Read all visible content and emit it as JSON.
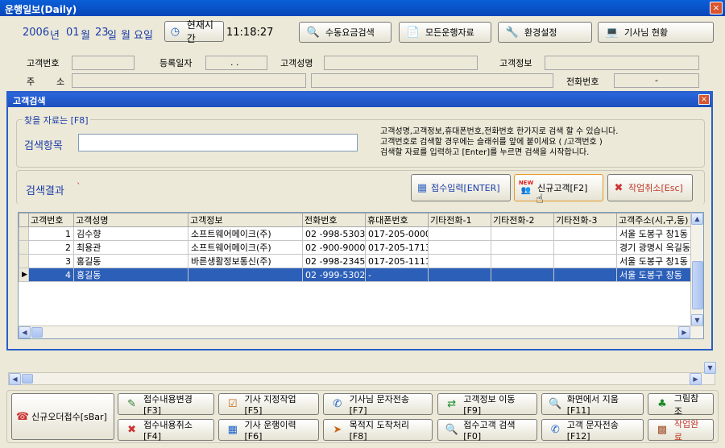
{
  "window": {
    "title": "운행일보(Daily)",
    "close": "×"
  },
  "date": {
    "year": "2006",
    "year_unit": "년",
    "month": "01",
    "month_unit": "월",
    "day": "23",
    "day_unit": "일",
    "weekday": "월",
    "weekday_unit": "요일"
  },
  "clock": {
    "button_label": "현재시간",
    "time": "11:18:27"
  },
  "toolbar": {
    "manual_fare": "수동요금검색",
    "all_trips": "모든운행자료",
    "settings": "환경설정",
    "driver_status": "기사님 현황"
  },
  "customer_form": {
    "customer_no": "고객번호",
    "reg_date": "등록일자",
    "reg_date_value": ".    .",
    "customer_name": "고객성명",
    "customer_info": "고객정보",
    "address_a": "주",
    "address_b": "소",
    "phone_no": "전화번호",
    "phone_value": "-"
  },
  "dialog": {
    "title": "고객검색",
    "close": "×",
    "search_group": "찾을 자료는 [F8]",
    "search_field_label": "검색항목",
    "search_value": "",
    "help_lines": [
      "고객성명,고객정보,휴대폰번호,전화번호 한가지로 검색 할 수 있습니다.",
      "고객번호로 검색할 경우에는 슬래쉬를 앞에 붙이세요 ( /고객번호 )",
      "검색할 자료를 입력하고 [Enter]를 누르면 검색을 시작합니다."
    ],
    "results_label": "검색결과",
    "results_mark": "`",
    "btn_receive": "접수입력[ENTER]",
    "btn_new_customer": "신규고객[F2]",
    "new_badge": "NEW",
    "btn_cancel": "작업취소[Esc]"
  },
  "table": {
    "columns": [
      "고객번호",
      "고객성명",
      "고객정보",
      "전화번호",
      "휴대폰번호",
      "기타전화-1",
      "기타전화-2",
      "기타전화-3",
      "고객주소(시,구,동)"
    ],
    "rows": [
      {
        "no": "1",
        "name": "김수향",
        "info": "소프트웨어메이크(주)",
        "phone": "02   -998-5303",
        "mobile": "017-205-0000",
        "e1": "",
        "e2": "",
        "e3": "",
        "addr": "서울 도봉구 창1동"
      },
      {
        "no": "2",
        "name": "최용관",
        "info": "소프트웨어메이크(주)",
        "phone": "02   -900-9000",
        "mobile": "017-205-1713",
        "e1": "",
        "e2": "",
        "e3": "",
        "addr": "경기 광명시 옥길동"
      },
      {
        "no": "3",
        "name": "홍길동",
        "info": "바른생활정보통신(주)",
        "phone": "02   -998-2345",
        "mobile": "017-205-1111",
        "e1": "",
        "e2": "",
        "e3": "",
        "addr": "서울 도봉구 창1동"
      },
      {
        "no": "4",
        "name": "홍길동",
        "info": "",
        "phone": "02   -999-5302",
        "mobile": "  -",
        "e1": "",
        "e2": "",
        "e3": "",
        "addr": "서울 도봉구 창동"
      }
    ],
    "selected_row_index": 3
  },
  "bottom": {
    "new_order": "신규오더접수[sBar]",
    "row1": [
      "접수내용변경[F3]",
      "기사 지정작업[F5]",
      "기사님 문자전송[F7]",
      "고객정보 이동[F9]",
      "화면에서 지움[F11]",
      "그림참조"
    ],
    "row2": [
      "접수내용취소[F4]",
      "기사 운행이력[F6]",
      "목적지 도착처리[F8]",
      "접수고객 검색[F0]",
      "고객 문자전송[F12]",
      "작업완료"
    ]
  }
}
